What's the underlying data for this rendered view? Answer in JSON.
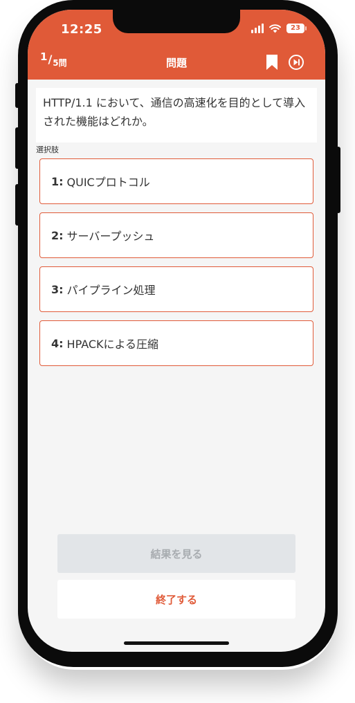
{
  "status_bar": {
    "time": "12:25",
    "battery": "23"
  },
  "header": {
    "counter_current": "1",
    "counter_slash": "/",
    "counter_total": "5問",
    "title": "問題",
    "icons": [
      "bookmark-icon",
      "skip-forward-icon"
    ]
  },
  "question": {
    "text": "HTTP/1.1 において、通信の高速化を目的として導入された機能はどれか。"
  },
  "choices_label": "選択肢",
  "choices": [
    {
      "number": "1:",
      "text": "QUICプロトコル"
    },
    {
      "number": "2:",
      "text": "サーバープッシュ"
    },
    {
      "number": "3:",
      "text": "パイプライン処理"
    },
    {
      "number": "4:",
      "text": "HPACKによる圧縮"
    }
  ],
  "buttons": {
    "result": "結果を見る",
    "end": "終了する"
  },
  "colors": {
    "accent": "#e05a38",
    "background": "#f5f5f5",
    "disabled_bg": "#e2e5e8",
    "disabled_text": "#a8acb0",
    "text": "#333333"
  }
}
